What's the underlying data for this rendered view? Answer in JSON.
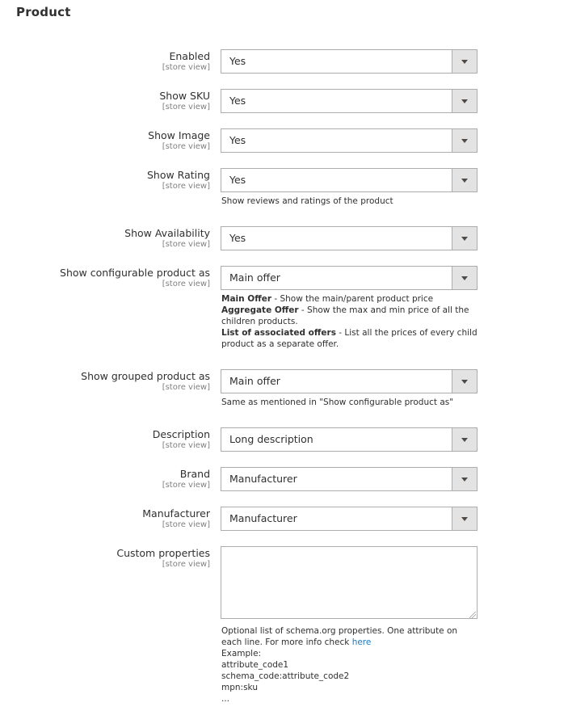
{
  "section": {
    "title": "Product"
  },
  "scope_label": "[store view]",
  "fields": [
    {
      "label": "Enabled",
      "scope": "[store view]",
      "value": "Yes"
    },
    {
      "label": "Show SKU",
      "scope": "[store view]",
      "value": "Yes"
    },
    {
      "label": "Show Image",
      "scope": "[store view]",
      "value": "Yes"
    },
    {
      "label": "Show Rating",
      "scope": "[store view]",
      "value": "Yes",
      "note": "Show reviews and ratings of the product"
    },
    {
      "label": "Show Availability",
      "scope": "[store view]",
      "value": "Yes"
    },
    {
      "label": "Show configurable product as",
      "scope": "[store view]",
      "value": "Main offer",
      "note_items": [
        {
          "term": "Main Offer",
          "desc": " - Show the main/parent product price"
        },
        {
          "term": "Aggregate Offer",
          "desc": " - Show the max and min price of all the children products."
        },
        {
          "term": "List of associated offers",
          "desc": " - List all the prices of every child product as a separate offer."
        }
      ]
    },
    {
      "label": "Show grouped product as",
      "scope": "[store view]",
      "value": "Main offer",
      "note": "Same as mentioned in \"Show configurable product as\""
    },
    {
      "label": "Description",
      "scope": "[store view]",
      "value": "Long description"
    },
    {
      "label": "Brand",
      "scope": "[store view]",
      "value": "Manufacturer"
    },
    {
      "label": "Manufacturer",
      "scope": "[store view]",
      "value": "Manufacturer"
    },
    {
      "label": "Custom properties",
      "scope": "[store view]",
      "value": "",
      "note_intro": "Optional list of schema.org properties. One attribute on each line. For more info check ",
      "note_link": "here",
      "note_lines": [
        "Example:",
        "attribute_code1",
        "schema_code:attribute_code2",
        "mpn:sku",
        "..."
      ]
    }
  ]
}
